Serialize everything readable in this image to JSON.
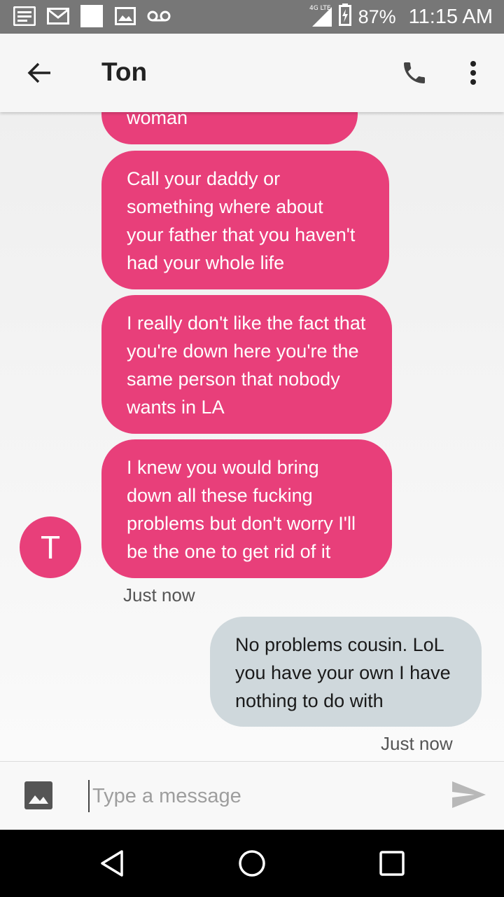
{
  "status_bar": {
    "network": "4G LTE",
    "battery": "87%",
    "time": "11:15 AM",
    "icons": [
      "notes-icon",
      "gmail-icon",
      "blank-square-icon",
      "image-icon",
      "voicemail-icon"
    ]
  },
  "app_bar": {
    "title": "Ton"
  },
  "messages": [
    {
      "direction": "incoming",
      "text": "woman"
    },
    {
      "direction": "incoming",
      "text": "Call your daddy or something where about your father that you haven't had your whole life"
    },
    {
      "direction": "incoming",
      "text": "I really don't like the fact that you're down here you're the same person that nobody wants in LA"
    },
    {
      "direction": "incoming",
      "text": "I knew you would bring down all these fucking problems but don't worry I'll be the one to get rid of it"
    },
    {
      "direction": "outgoing",
      "text": "No problems cousin. LoL you have your own I have nothing to do with"
    }
  ],
  "avatar": {
    "letter": "T"
  },
  "timestamps": {
    "incoming": "Just now",
    "outgoing": "Just now"
  },
  "compose": {
    "placeholder": "Type a message"
  },
  "colors": {
    "incoming_bubble": "#e83f7a",
    "outgoing_bubble": "#cfd8dc",
    "status_bar": "#777777"
  }
}
